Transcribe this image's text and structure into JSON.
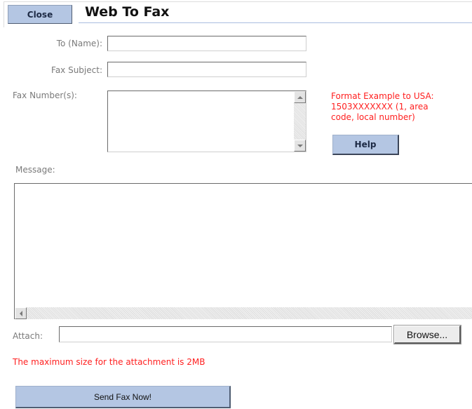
{
  "header": {
    "close_label": "Close",
    "title": "Web To Fax"
  },
  "form": {
    "to_name": {
      "label": "To (Name):",
      "value": ""
    },
    "fax_subject": {
      "label": "Fax Subject:",
      "value": ""
    },
    "fax_numbers": {
      "label": "Fax Number(s):",
      "value": ""
    },
    "format_hint": [
      "Format Example to USA:",
      "1503XXXXXXX (1, area",
      "code, local number)"
    ],
    "help_label": "Help",
    "message": {
      "label": "Message:",
      "value": ""
    },
    "attach": {
      "label": "Attach:",
      "value": "",
      "browse_label": "Browse..."
    },
    "attach_note": "The maximum size for the attachment is 2MB",
    "send_label": "Send Fax Now!"
  },
  "colors": {
    "button_blue": "#b4c6e3",
    "hint_red": "#ff1f1f",
    "label_gray": "#7a7a7a"
  }
}
